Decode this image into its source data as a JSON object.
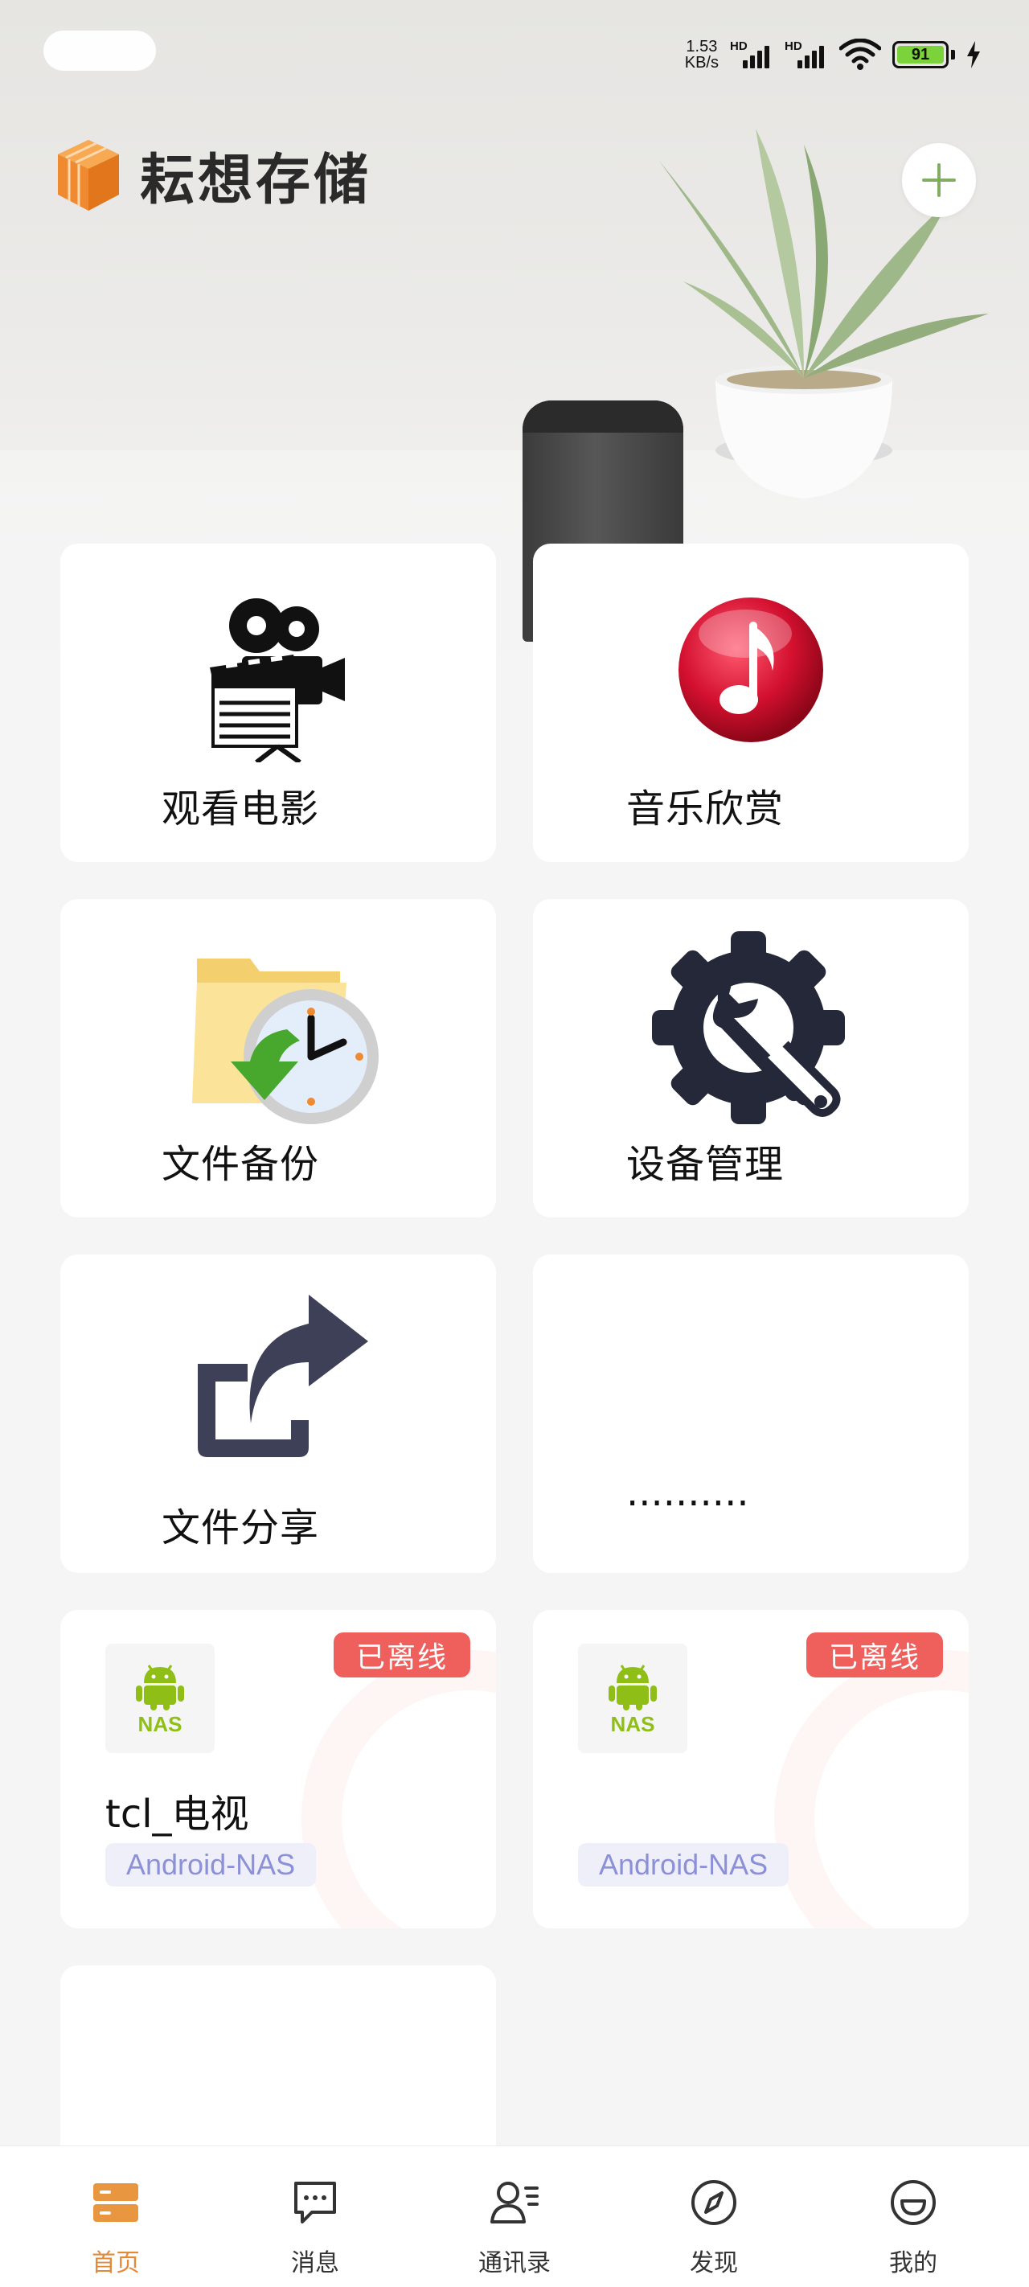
{
  "status_bar": {
    "net_speed_value": "1.53",
    "net_speed_unit": "KB/s",
    "signal_1_label": "HD",
    "signal_2_label": "HD",
    "battery_level": "91"
  },
  "header": {
    "app_title": "耘想存储"
  },
  "features": [
    {
      "label": "观看电影",
      "icon": "movie-camera-icon"
    },
    {
      "label": "音乐欣赏",
      "icon": "music-note-icon"
    },
    {
      "label": "文件备份",
      "icon": "folder-clock-icon"
    },
    {
      "label": "设备管理",
      "icon": "gear-wrench-icon"
    },
    {
      "label": "文件分享",
      "icon": "share-arrow-icon"
    },
    {
      "label": "..........",
      "icon": ""
    }
  ],
  "devices": [
    {
      "name": "tcl_电视",
      "type": "Android-NAS",
      "status": "已离线",
      "icon_text": "NAS"
    },
    {
      "name": "",
      "type": "Android-NAS",
      "status": "已离线",
      "icon_text": "NAS"
    }
  ],
  "bottom_nav": [
    {
      "label": "首页",
      "icon": "home-server-icon",
      "active": true
    },
    {
      "label": "消息",
      "icon": "message-icon",
      "active": false
    },
    {
      "label": "通讯录",
      "icon": "contacts-icon",
      "active": false
    },
    {
      "label": "发现",
      "icon": "compass-icon",
      "active": false
    },
    {
      "label": "我的",
      "icon": "profile-icon",
      "active": false
    }
  ],
  "colors": {
    "accent": "#e28a3a",
    "offline_badge": "#ef5f5c",
    "type_tag_bg": "#efeffa",
    "type_tag_text": "#8c90d6",
    "android_green": "#8fbf16"
  }
}
